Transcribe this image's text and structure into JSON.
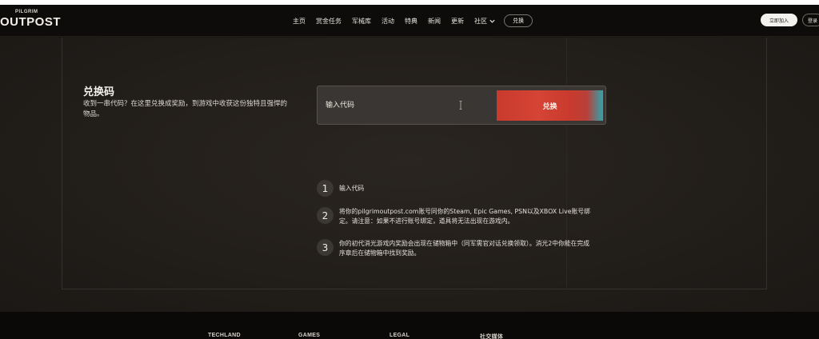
{
  "header": {
    "logo_small": "PILGRIM",
    "logo_text": "OUTPOST",
    "nav": [
      "主页",
      "赏金任务",
      "军械库",
      "活动",
      "特典",
      "新闻",
      "更新"
    ],
    "community": "社区",
    "redeem": "兑换",
    "join": "立即加入",
    "login": "登录"
  },
  "redeem": {
    "title": "兑换码",
    "description": "收到一串代码？在这里兑换成奖励，到游戏中收获这份独特且强悍的物品。",
    "input_placeholder": "输入代码",
    "button_label": "兑换",
    "accent_colors": [
      "#c93a2e",
      "#2ea6ad"
    ]
  },
  "steps": [
    {
      "num": "1",
      "text": "输入代码"
    },
    {
      "num": "2",
      "text": "将你的pilgrimoutpost.com账号同你的Steam, Epic Games, PSN以及XBOX Live账号绑定。请注意：如果不进行账号绑定，道具将无法出现在游戏内。"
    },
    {
      "num": "3",
      "text": "你的初代消光游戏内奖励会出现在储物箱中（同军需官对话兑换领取）。消光2中你能在完成序章后在储物箱中找到奖励。"
    }
  ],
  "footer": {
    "columns": [
      "TECHLAND",
      "GAMES",
      "LEGAL",
      "社交媒体"
    ]
  }
}
